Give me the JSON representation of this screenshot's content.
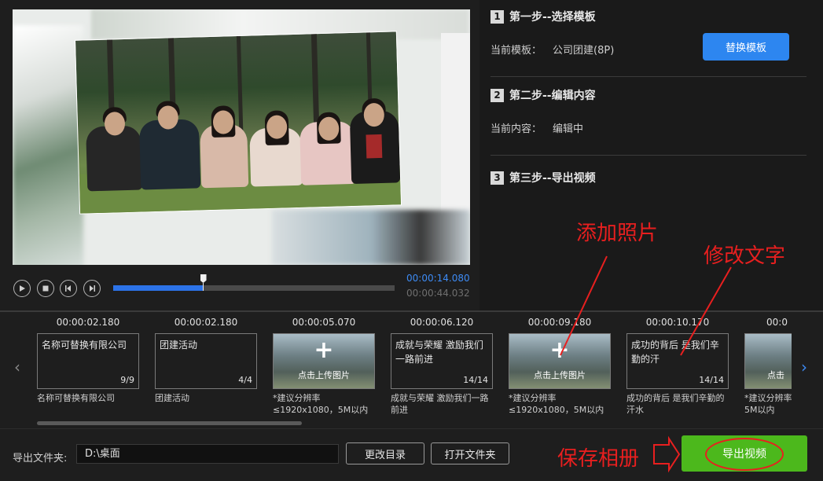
{
  "player": {
    "current_time": "00:00:14.080",
    "total_time": "00:00:44.032",
    "progress": 0.32
  },
  "steps": [
    {
      "num": "1",
      "title": "第一步--选择模板"
    },
    {
      "num": "2",
      "title": "第二步--编辑内容"
    },
    {
      "num": "3",
      "title": "第三步--导出视频"
    }
  ],
  "template_info": {
    "label": "当前模板：",
    "value": "公司团建(8P)",
    "button": "替换模板"
  },
  "content_info": {
    "label": "当前内容：",
    "value": "编辑中"
  },
  "annotations": {
    "add_photo": "添加照片",
    "edit_text": "修改文字",
    "save_album": "保存相册"
  },
  "timeline": [
    {
      "time": "00:00:02.180",
      "type": "text",
      "text": "名称可替换有限公司",
      "count": "9/9",
      "caption": "名称可替换有限公司"
    },
    {
      "time": "00:00:02.180",
      "type": "text",
      "text": "团建活动",
      "count": "4/4",
      "caption": "团建活动"
    },
    {
      "time": "00:00:05.070",
      "type": "photo",
      "upload_label": "点击上传图片",
      "caption": "*建议分辨率≤1920x1080，5M以内"
    },
    {
      "time": "00:00:06.120",
      "type": "text",
      "text": "成就与荣耀 激励我们一路前进",
      "count": "14/14",
      "caption": "成就与荣耀 激励我们一路前进"
    },
    {
      "time": "00:00:09.180",
      "type": "photo",
      "upload_label": "点击上传图片",
      "caption": "*建议分辨率≤1920x1080，5M以内"
    },
    {
      "time": "00:00:10.170",
      "type": "text",
      "text": "成功的背后 是我们辛勤的汗",
      "count": "14/14",
      "caption": "成功的背后 是我们辛勤的汗水"
    },
    {
      "time": "00:0",
      "type": "photo",
      "upload_label": "点击",
      "caption": "*建议分辨率\n5M以内"
    }
  ],
  "export": {
    "label": "导出文件夹:",
    "path": "D:\\桌面",
    "change_dir": "更改目录",
    "open_folder": "打开文件夹",
    "export_button": "导出视频"
  },
  "colors": {
    "accent_blue": "#2d86f0",
    "export_green": "#4cb81c",
    "annotation_red": "#e81f1f"
  }
}
